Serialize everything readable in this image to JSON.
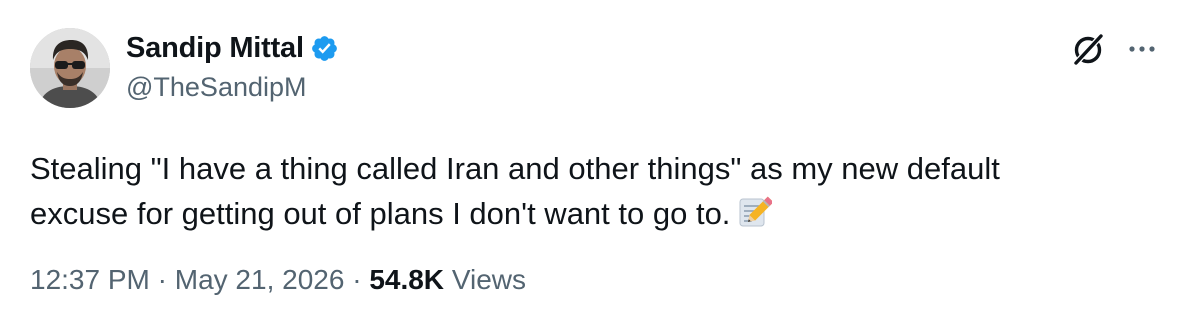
{
  "author": {
    "display_name": "Sandip Mittal",
    "handle": "@TheSandipM",
    "verified": true,
    "verified_color": "#1d9bf0"
  },
  "tweet": {
    "text_lines": [
      "Stealing \"I have a thing called Iran and other things\" as my new default",
      "excuse for getting out of plans I don't want to go to."
    ],
    "emoji": "memo"
  },
  "meta": {
    "time": "12:37 PM",
    "separator": "·",
    "date": "May 21, 2026",
    "views_count": "54.8K",
    "views_label": "Views"
  },
  "icons": {
    "grok": "grok-icon",
    "more": "more-icon"
  },
  "colors": {
    "text_primary": "#0f1419",
    "text_secondary": "#536471",
    "accent": "#1d9bf0"
  }
}
